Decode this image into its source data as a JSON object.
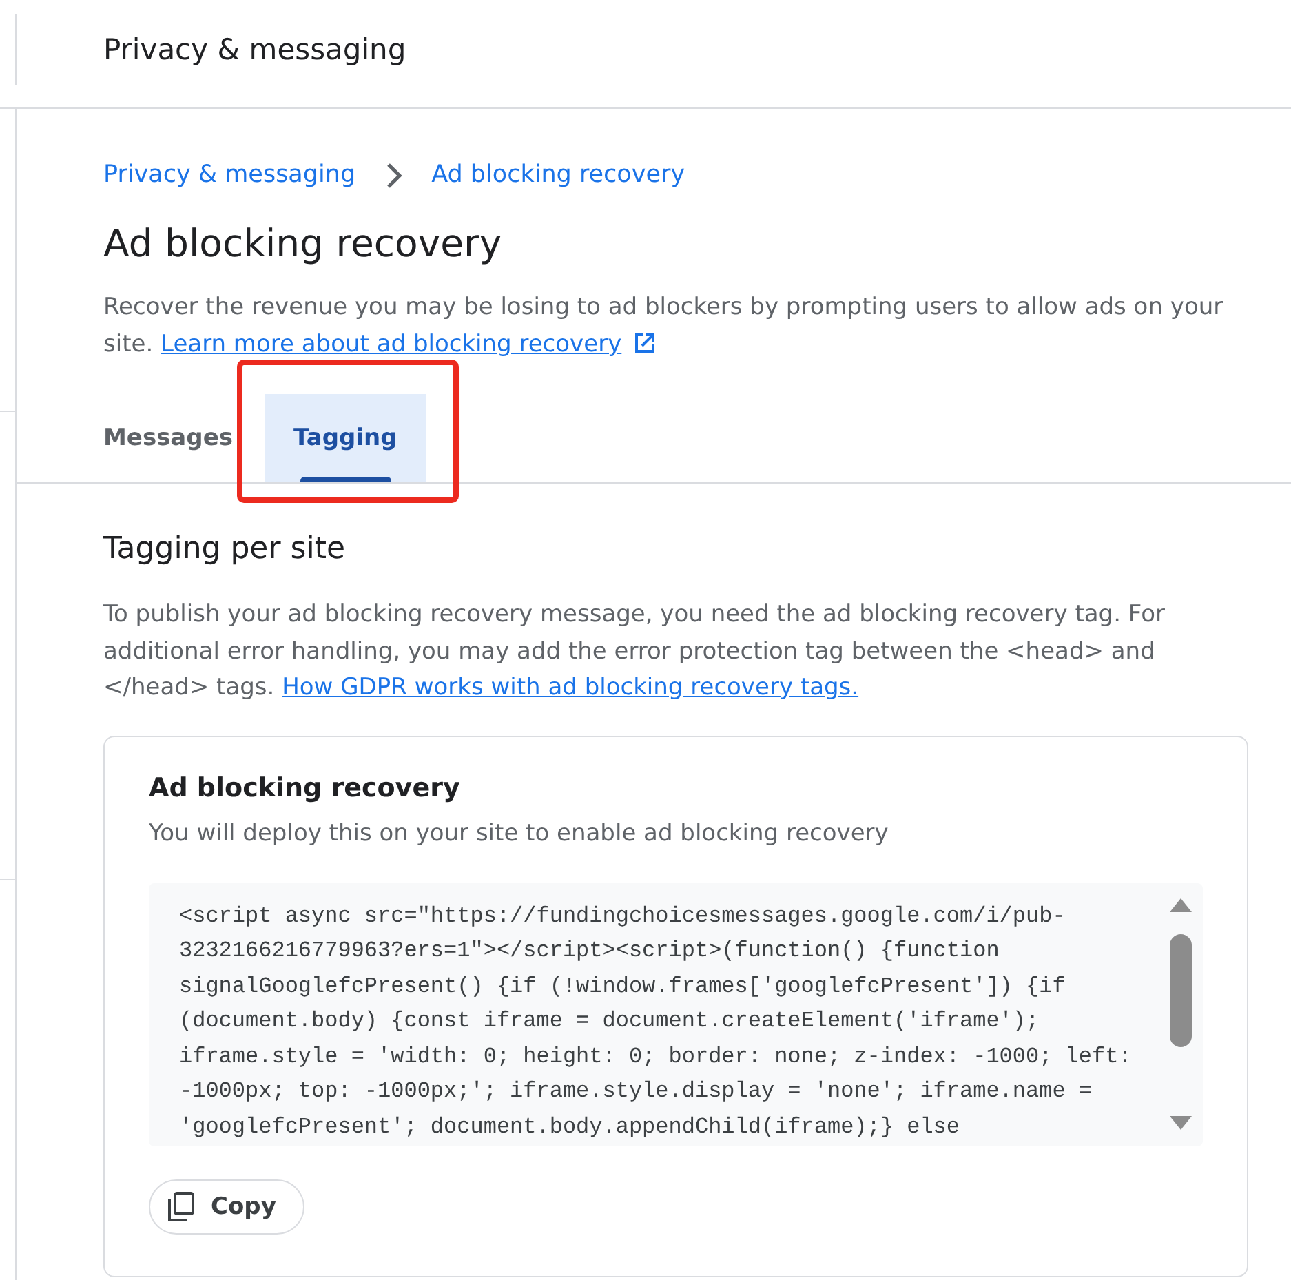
{
  "header": {
    "title": "Privacy & messaging"
  },
  "breadcrumb": [
    {
      "label": "Privacy & messaging"
    },
    {
      "label": "Ad blocking recovery"
    }
  ],
  "page": {
    "title": "Ad blocking recovery",
    "description": "Recover the revenue you may be losing to ad blockers by prompting users to allow ads on your site.",
    "link": {
      "label": "Learn more about ad blocking recovery",
      "external": true
    }
  },
  "tabs": [
    {
      "label": "Messages",
      "selected": false,
      "highlighted": false
    },
    {
      "label": "Tagging",
      "selected": true,
      "highlighted": true
    }
  ],
  "section": {
    "title": "Tagging per site",
    "text": "To publish your ad blocking recovery message, you need the ad blocking recovery tag. For additional error handling, you may add the error protection tag between the <head> and </head> tags.",
    "link": {
      "label": "How GDPR works with ad blocking recovery tags."
    }
  },
  "card": {
    "title": "Ad blocking recovery",
    "subtitle": "You will deploy this on your site to enable ad blocking recovery",
    "code_lines": [
      "<script async src=\"https://fundingchoicesmessages.google.com/i/pub-",
      "3232166216779963?ers=1\"></script><script>(function() {function",
      "signalGooglefcPresent() {if (!window.frames['googlefcPresent']) {if",
      "(document.body) {const iframe = document.createElement('iframe');",
      "iframe.style = 'width: 0; height: 0; border: none; z-index: -1000; left:",
      "-1000px; top: -1000px;'; iframe.style.display = 'none'; iframe.name =",
      "'googlefcPresent'; document.body.appendChild(iframe);} else"
    ],
    "copy_button": {
      "label": "Copy"
    }
  }
}
